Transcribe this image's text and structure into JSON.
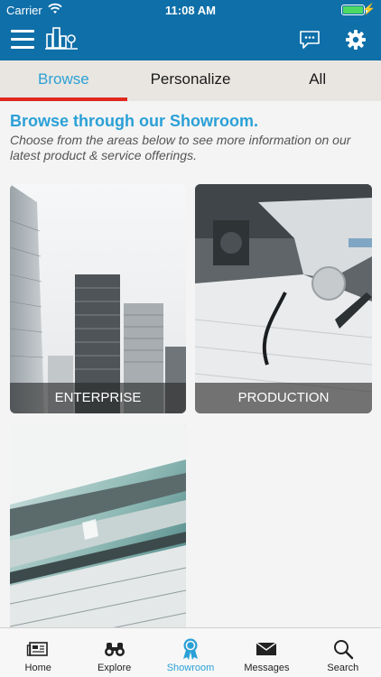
{
  "status": {
    "carrier": "Carrier",
    "time": "11:08 AM",
    "battery_level": 1.0
  },
  "header": {
    "menu_icon": "hamburger-icon",
    "logo_icon": "city-logo-icon",
    "messages_icon": "chat-bubble-icon",
    "settings_icon": "gear-icon"
  },
  "tabs": [
    {
      "label": "Browse",
      "active": true
    },
    {
      "label": "Personalize",
      "active": false
    },
    {
      "label": "All",
      "active": false
    }
  ],
  "intro": {
    "headline": "Browse through our Showroom.",
    "description": "Choose from the areas below to see more information on our latest product & service offerings."
  },
  "tiles": [
    {
      "label": "ENTERPRISE"
    },
    {
      "label": "PRODUCTION"
    },
    {
      "label": ""
    }
  ],
  "bottom_nav": [
    {
      "label": "Home",
      "icon": "newspaper-icon",
      "active": false
    },
    {
      "label": "Explore",
      "icon": "binoculars-icon",
      "active": false
    },
    {
      "label": "Showroom",
      "icon": "award-ribbon-icon",
      "active": true
    },
    {
      "label": "Messages",
      "icon": "envelope-icon",
      "active": false
    },
    {
      "label": "Search",
      "icon": "magnifier-icon",
      "active": false
    }
  ],
  "colors": {
    "brand_blue": "#0f6fa8",
    "accent_blue": "#2ba0d6",
    "active_tab_underline": "#e0281e"
  }
}
